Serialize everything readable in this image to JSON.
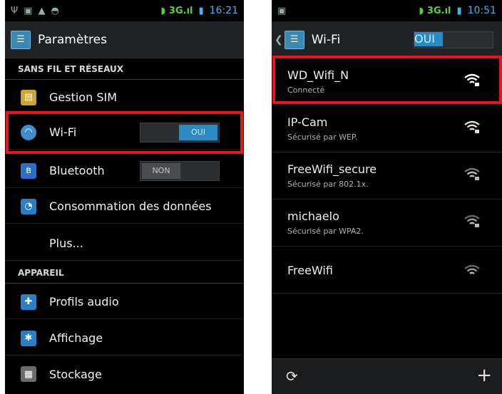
{
  "left": {
    "status": {
      "time": "16:21",
      "network": "3G"
    },
    "title": "Paramètres",
    "sections": {
      "wireless": "SANS FIL ET RÉSEAUX",
      "device": "APPAREIL"
    },
    "items": {
      "sim": "Gestion SIM",
      "wifi": "Wi-Fi",
      "bluetooth": "Bluetooth",
      "data": "Consommation des données",
      "more": "Plus...",
      "audio": "Profils audio",
      "display": "Affichage",
      "storage": "Stockage"
    },
    "toggles": {
      "wifi": "OUI",
      "bluetooth": "NON"
    }
  },
  "right": {
    "status": {
      "time": "10:51",
      "network": "3G"
    },
    "title": "Wi-Fi",
    "toggle": "OUI",
    "networks": [
      {
        "ssid": "WD_Wifi_N",
        "status": "Connecté"
      },
      {
        "ssid": "IP-Cam",
        "status": "Sécurisé par WEP."
      },
      {
        "ssid": "FreeWifi_secure",
        "status": "Sécurisé par 802.1x."
      },
      {
        "ssid": "michaelo",
        "status": "Sécurisé par WPA2."
      },
      {
        "ssid": "FreeWifi",
        "status": ""
      }
    ]
  },
  "colors": {
    "accent": "#2a8ac4",
    "highlight": "#e8151b",
    "signal": "#5bd03f"
  }
}
